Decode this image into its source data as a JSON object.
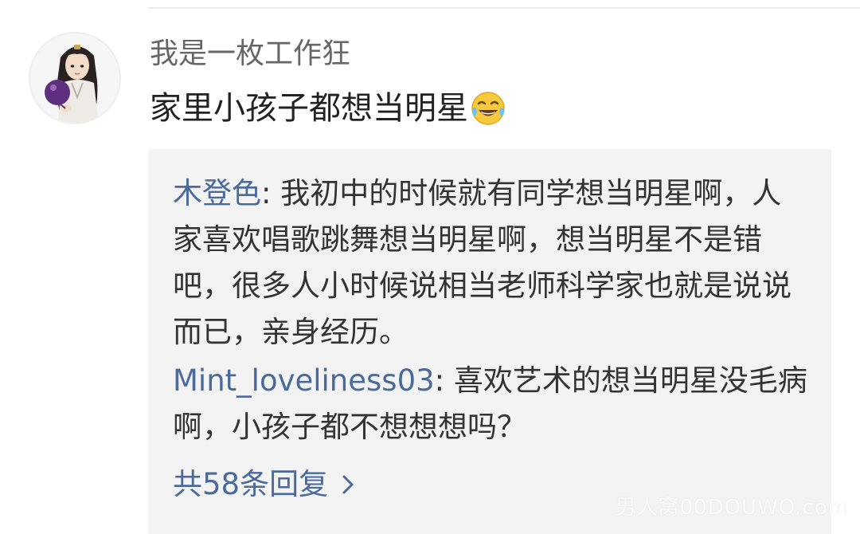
{
  "comment": {
    "username": "我是一枚工作狂",
    "text": "家里小孩子都想当明星",
    "emoji": "laugh-cry-emoji"
  },
  "replies": [
    {
      "author": "木登色",
      "separator": ": ",
      "text": "我初中的时候就有同学想当明星啊，人家喜欢唱歌跳舞想当明星啊，想当明星不是错吧，很多人小时候说相当老师科学家也就是说说而已，亲身经历。"
    },
    {
      "author": "Mint_loveliness03",
      "separator": ": ",
      "text": "喜欢艺术的想当明星没毛病啊，小孩子都不想想想吗？"
    }
  ],
  "more_replies_label": "共58条回复",
  "watermark": "男人窝00DOUWO.com",
  "colors": {
    "link": "#4a6a9c",
    "reply_background": "#f3f3f3",
    "username": "#666666",
    "text": "#222222"
  }
}
